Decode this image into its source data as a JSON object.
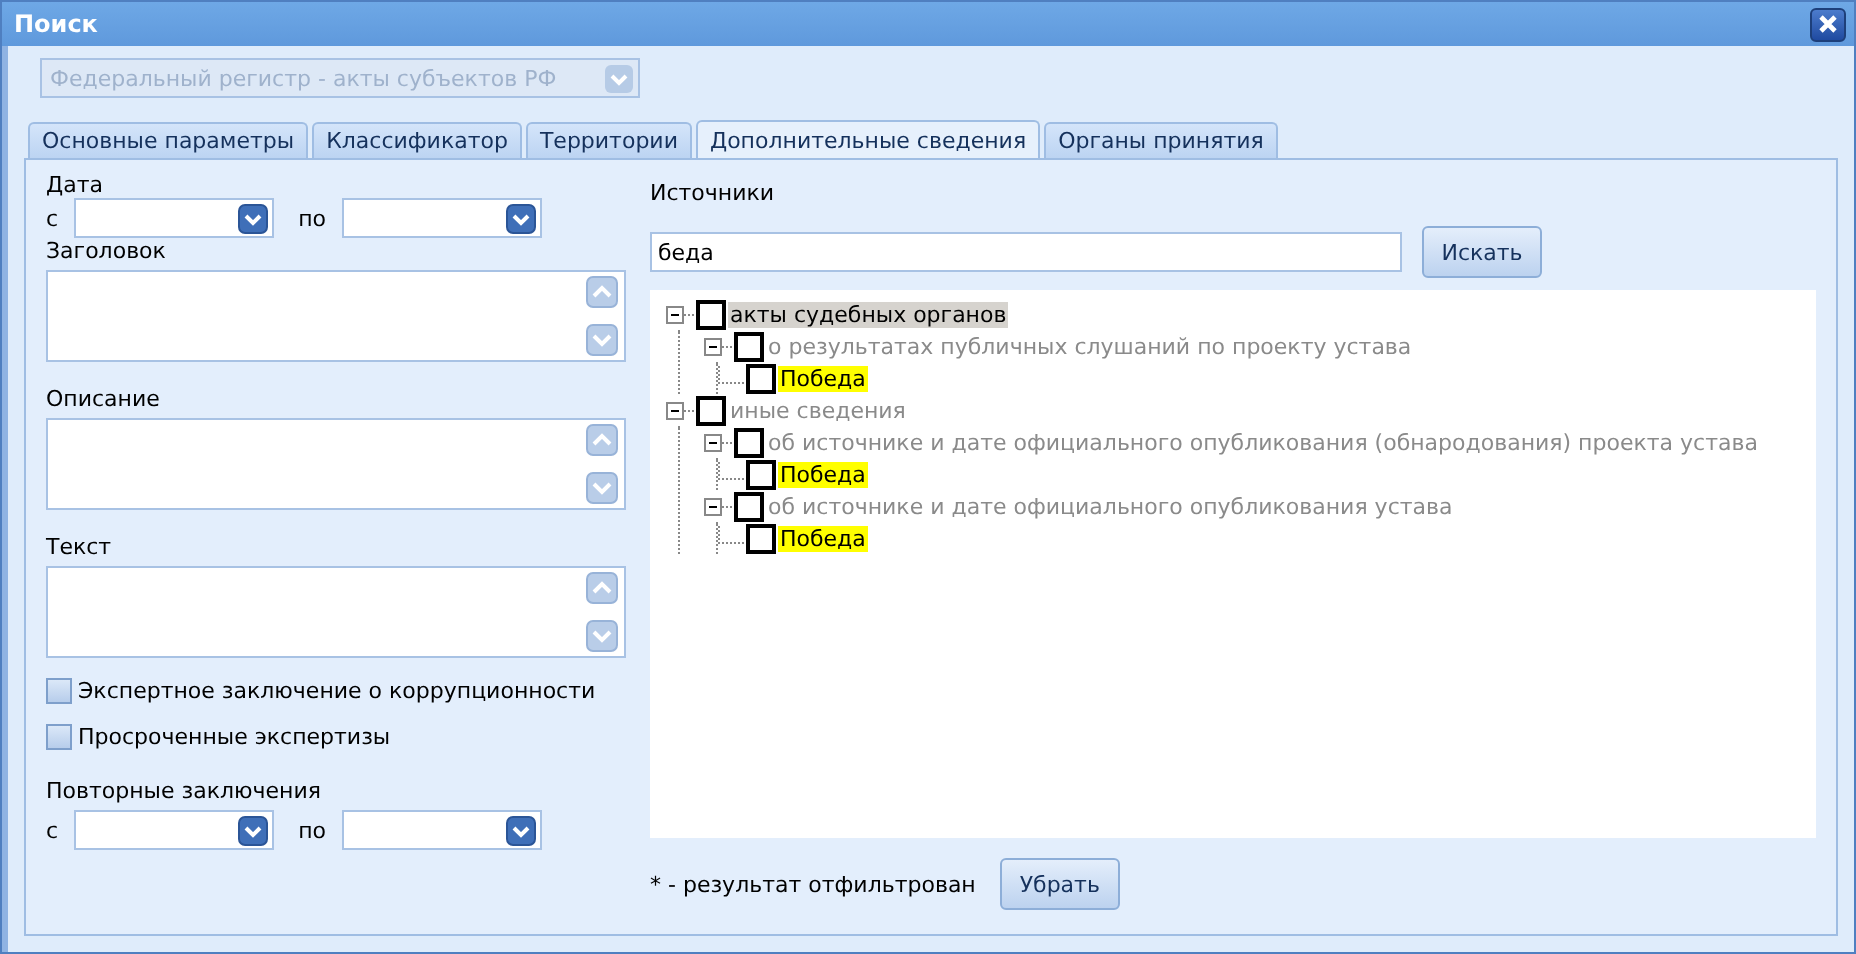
{
  "window": {
    "title": "Поиск"
  },
  "register_select": {
    "value": "Федеральный регистр - акты субъектов РФ",
    "disabled": true
  },
  "tabs": [
    {
      "label": "Основные параметры",
      "selected": false
    },
    {
      "label": "Классификатор",
      "selected": false
    },
    {
      "label": "Территории",
      "selected": false
    },
    {
      "label": "Дополнительные сведения",
      "selected": true
    },
    {
      "label": "Органы принятия",
      "selected": false
    }
  ],
  "date": {
    "label": "Дата",
    "from_label": "с",
    "to_label": "по"
  },
  "text_areas": [
    {
      "label": "Заголовок"
    },
    {
      "label": "Описание"
    },
    {
      "label": "Текст"
    }
  ],
  "checkboxes": [
    {
      "label": "Экспертное заключение о коррупционности",
      "checked": false
    },
    {
      "label": "Просроченные экспертизы",
      "checked": false
    }
  ],
  "repeat": {
    "label": "Повторные заключения",
    "from_label": "с",
    "to_label": "по"
  },
  "sources": {
    "label": "Источники",
    "search_value": "беда",
    "search_button": "Искать",
    "tree": [
      {
        "label": "акты судебных органов",
        "selected": true,
        "match": false,
        "checked": false,
        "expanded": true,
        "children": [
          {
            "label": "о результатах публичных слушаний по проекту устава",
            "selected": false,
            "match": false,
            "checked": false,
            "expanded": true,
            "children": [
              {
                "label": "Победа",
                "selected": false,
                "match": true,
                "checked": false
              }
            ]
          }
        ]
      },
      {
        "label": "иные сведения",
        "selected": false,
        "match": false,
        "checked": false,
        "expanded": true,
        "children": [
          {
            "label": "об источнике и дате официального опубликования (обнародования) проекта устава",
            "selected": false,
            "match": false,
            "checked": false,
            "expanded": true,
            "children": [
              {
                "label": "Победа",
                "selected": false,
                "match": true,
                "checked": false
              }
            ]
          },
          {
            "label": "об источнике и дате официального опубликования устава",
            "selected": false,
            "match": false,
            "checked": false,
            "expanded": true,
            "children": [
              {
                "label": "Победа",
                "selected": false,
                "match": true,
                "checked": false
              }
            ]
          }
        ]
      }
    ],
    "filter_note": "* - результат отфильтрован",
    "remove_button": "Убрать"
  }
}
